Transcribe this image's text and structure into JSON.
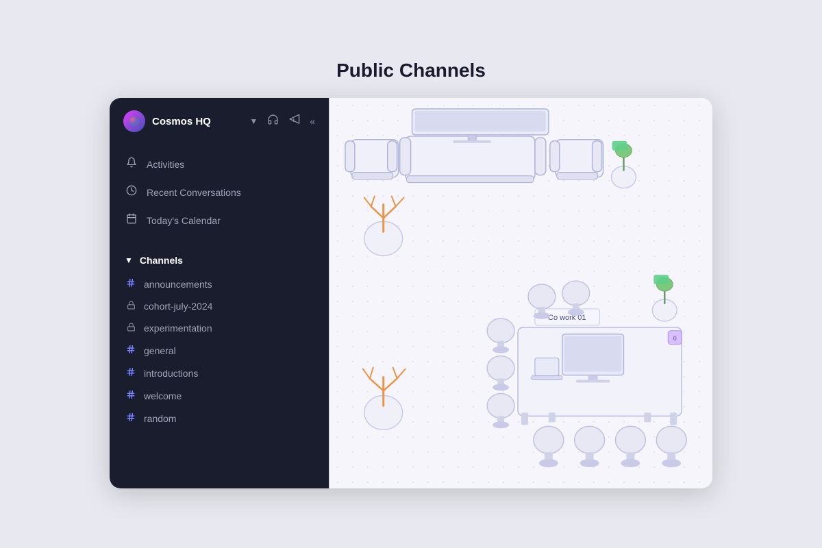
{
  "page": {
    "title": "Public Channels"
  },
  "sidebar": {
    "workspace": {
      "name": "Cosmos HQ"
    },
    "nav_items": [
      {
        "id": "activities",
        "label": "Activities",
        "icon": "🔔"
      },
      {
        "id": "recent-conversations",
        "label": "Recent Conversations",
        "icon": "🕐"
      },
      {
        "id": "todays-calendar",
        "label": "Today's Calendar",
        "icon": "📅"
      }
    ],
    "channels_section": {
      "label": "Channels",
      "items": [
        {
          "id": "announcements",
          "label": "announcements",
          "type": "hash"
        },
        {
          "id": "cohort-july-2024",
          "label": "cohort-july-2024",
          "type": "lock"
        },
        {
          "id": "experimentation",
          "label": "experimentation",
          "type": "lock"
        },
        {
          "id": "general",
          "label": "general",
          "type": "hash"
        },
        {
          "id": "introductions",
          "label": "introductions",
          "type": "hash"
        },
        {
          "id": "welcome",
          "label": "welcome",
          "type": "hash"
        },
        {
          "id": "random",
          "label": "random",
          "type": "hash"
        }
      ]
    }
  },
  "header_icons": {
    "headphones": "🎧",
    "megaphone": "📢",
    "collapse": "«"
  }
}
